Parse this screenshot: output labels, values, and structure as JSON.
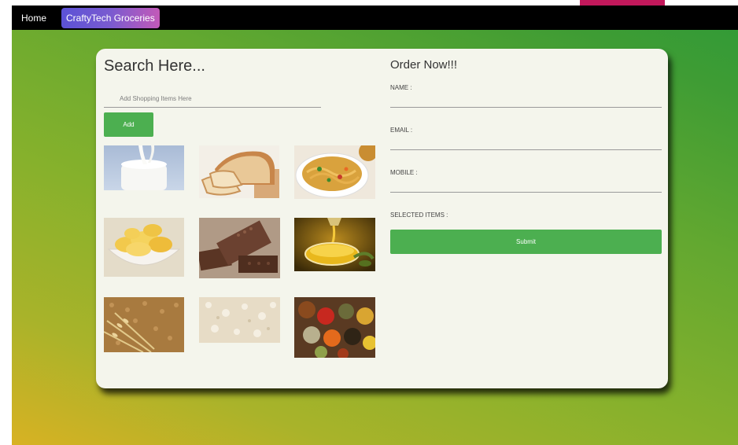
{
  "nav": {
    "home_label": "Home",
    "brand_label": "CraftyTech Groceries"
  },
  "search": {
    "title": "Search Here...",
    "placeholder": "Add Shopping Items Here",
    "add_label": "Add"
  },
  "products": [
    {
      "icon": "milk-image"
    },
    {
      "icon": "bread-image"
    },
    {
      "icon": "noodles-image"
    },
    {
      "icon": "chips-image"
    },
    {
      "icon": "chocolate-image"
    },
    {
      "icon": "oil-image"
    },
    {
      "icon": "wheat-image"
    },
    {
      "icon": "flour-image"
    },
    {
      "icon": "spices-image"
    }
  ],
  "order": {
    "title": "Order Now!!!",
    "name_label": "NAME :",
    "email_label": "EMAIL :",
    "mobile_label": "MOBILE :",
    "selected_label": "SELECTED ITEMS :",
    "submit_label": "Submit"
  },
  "colors": {
    "accent_button": "#4caf50",
    "navbar": "#000000",
    "brand_gradient_start": "#5b52d6",
    "brand_gradient_end": "#c35ab8",
    "top_strip": "#c2185b"
  }
}
